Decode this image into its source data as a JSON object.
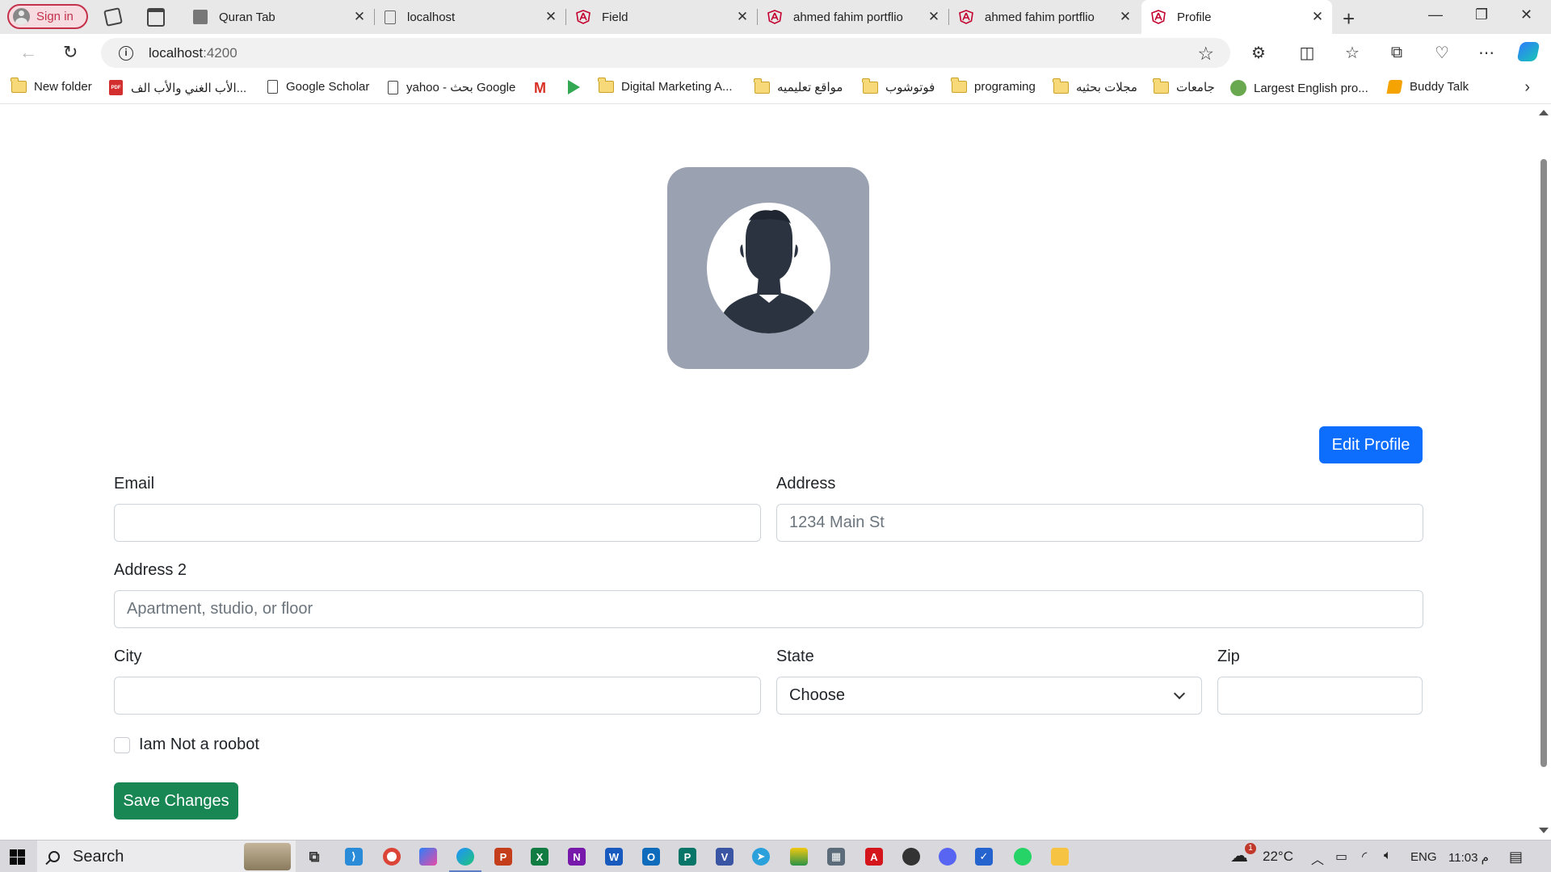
{
  "browser": {
    "signin_label": "Sign in",
    "tabs": [
      {
        "title": "Quran Tab",
        "favicon": "grey-square-icon"
      },
      {
        "title": "localhost",
        "favicon": "document-icon"
      },
      {
        "title": "Field",
        "favicon": "angular-icon"
      },
      {
        "title": "ahmed fahim portflio",
        "favicon": "angular-icon"
      },
      {
        "title": "ahmed fahim portflio",
        "favicon": "angular-icon"
      },
      {
        "title": "Profile",
        "favicon": "angular-icon",
        "active": true
      }
    ],
    "url_host": "localhost",
    "url_port": ":4200",
    "bookmarks": [
      {
        "label": "New folder",
        "icon": "folder-icon"
      },
      {
        "label": "الأب الغني والأب الف...",
        "icon": "pdf-icon"
      },
      {
        "label": "Google Scholar",
        "icon": "page-icon"
      },
      {
        "label": "yahoo - بحث Google",
        "icon": "page-icon"
      },
      {
        "label": "",
        "icon": "gmail-icon"
      },
      {
        "label": "",
        "icon": "google-play-icon"
      },
      {
        "label": "Digital Marketing A...",
        "icon": "folder-icon"
      },
      {
        "label": "مواقع تعليميه",
        "icon": "folder-icon"
      },
      {
        "label": "فوتوشوب",
        "icon": "folder-icon"
      },
      {
        "label": "programing",
        "icon": "folder-icon"
      },
      {
        "label": "مجلات بحثيه",
        "icon": "folder-icon"
      },
      {
        "label": "جامعات",
        "icon": "folder-icon"
      },
      {
        "label": "Largest English pro...",
        "icon": "globe-icon"
      },
      {
        "label": "Buddy Talk",
        "icon": "buddy-icon"
      }
    ]
  },
  "profile": {
    "edit_button": "Edit Profile",
    "email_label": "Email",
    "email_value": "",
    "address_label": "Address",
    "address_placeholder": "1234 Main St",
    "address2_label": "Address 2",
    "address2_placeholder": "Apartment, studio, or floor",
    "city_label": "City",
    "city_value": "",
    "state_label": "State",
    "state_selected": "Choose",
    "zip_label": "Zip",
    "zip_value": "",
    "checkbox_label": "Iam Not a roobot",
    "checkbox_checked": false,
    "save_button": "Save Changes"
  },
  "colors": {
    "primary": "#0d6efd",
    "success": "#198754",
    "avatar_bg": "#9aa2b1",
    "avatar_silhouette": "#2b3340"
  },
  "taskbar": {
    "search_label": "Search",
    "weather_temp": "22°C",
    "weather_badge": "1",
    "language": "ENG",
    "clock": "11:03 م"
  }
}
